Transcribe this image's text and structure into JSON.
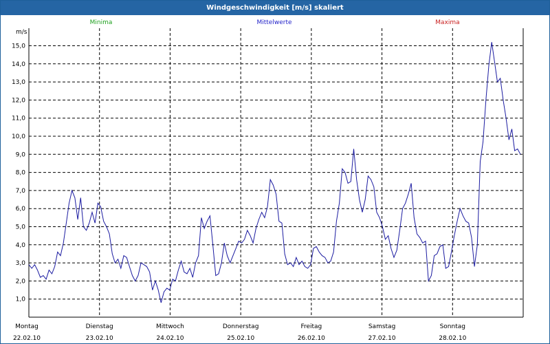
{
  "title": "Windgeschwindigkeit [m/s] skaliert",
  "colors": {
    "titlebar": "#2565a4",
    "minima": "#1ea01e",
    "mittelwerte": "#1f1fc8",
    "maxima": "#c81e1e",
    "line": "#1a1aa0"
  },
  "legend": {
    "minima": "Minima",
    "mittelwerte": "Mittelwerte",
    "maxima": "Maxima"
  },
  "chart_data": {
    "type": "line",
    "title": "Windgeschwindigkeit [m/s] skaliert",
    "ylabel": "m/s",
    "ylim": [
      0,
      16
    ],
    "yticks": [
      "1,0",
      "2,0",
      "3,0",
      "4,0",
      "5,0",
      "6,0",
      "7,0",
      "8,0",
      "9,0",
      "10,0",
      "11,0",
      "12,0",
      "13,0",
      "14,0",
      "15,0"
    ],
    "xlim_days": [
      0,
      7
    ],
    "grid": true,
    "legend_placement": "top",
    "day_labels": [
      {
        "day": "Montag",
        "date": "22.02.10"
      },
      {
        "day": "Dienstag",
        "date": "23.02.10"
      },
      {
        "day": "Mittwoch",
        "date": "24.02.10"
      },
      {
        "day": "Donnerstag",
        "date": "25.02.10"
      },
      {
        "day": "Freitag",
        "date": "26.02.10"
      },
      {
        "day": "Samstag",
        "date": "27.02.10"
      },
      {
        "day": "Sonntag",
        "date": "28.02.10"
      }
    ],
    "series": [
      {
        "name": "Mittelwerte",
        "values": [
          2.9,
          2.7,
          2.9,
          2.6,
          2.2,
          2.3,
          2.1,
          2.6,
          2.4,
          2.8,
          3.6,
          3.4,
          4.1,
          5.2,
          6.3,
          7.0,
          6.6,
          5.4,
          6.6,
          5.0,
          4.8,
          5.2,
          5.8,
          5.2,
          6.3,
          6.1,
          5.3,
          5.0,
          4.6,
          3.5,
          3.0,
          3.2,
          2.7,
          3.4,
          3.3,
          2.8,
          2.3,
          2.0,
          2.3,
          3.0,
          2.9,
          2.8,
          2.5,
          1.5,
          2.0,
          1.5,
          0.8,
          1.4,
          1.6,
          1.5,
          2.1,
          2.0,
          2.6,
          3.1,
          2.5,
          2.4,
          2.7,
          2.2,
          3.0,
          3.4,
          5.5,
          4.9,
          5.3,
          5.6,
          4.0,
          2.3,
          2.4,
          3.0,
          4.1,
          3.4,
          3.0,
          3.4,
          3.8,
          4.2,
          4.1,
          4.3,
          4.8,
          4.5,
          4.1,
          4.9,
          5.4,
          5.8,
          5.5,
          6.1,
          7.6,
          7.3,
          6.8,
          5.3,
          5.2,
          3.5,
          2.9,
          3.0,
          2.8,
          3.3,
          2.9,
          3.1,
          2.8,
          2.7,
          2.9,
          3.8,
          3.9,
          3.6,
          3.4,
          3.3,
          3.0,
          3.1,
          3.6,
          5.3,
          6.3,
          8.2,
          8.0,
          7.4,
          7.5,
          9.3,
          7.6,
          6.5,
          5.8,
          6.5,
          7.8,
          7.6,
          7.2,
          5.8,
          5.5,
          5.0,
          4.3,
          4.5,
          3.8,
          3.3,
          3.7,
          4.8,
          6.0,
          6.3,
          6.8,
          7.4,
          5.5,
          4.6,
          4.4,
          4.1,
          4.2,
          2.0,
          2.3,
          3.4,
          3.5,
          3.9,
          4.0,
          2.7,
          2.8,
          3.6,
          4.5,
          5.3,
          6.0,
          5.6,
          5.3,
          5.2,
          4.4,
          2.8,
          4.0,
          8.6,
          9.7,
          12.0,
          13.9,
          15.2,
          14.1,
          13.0,
          13.2,
          12.0,
          11.0,
          9.8,
          10.4,
          9.2,
          9.3,
          9.0
        ]
      }
    ]
  }
}
